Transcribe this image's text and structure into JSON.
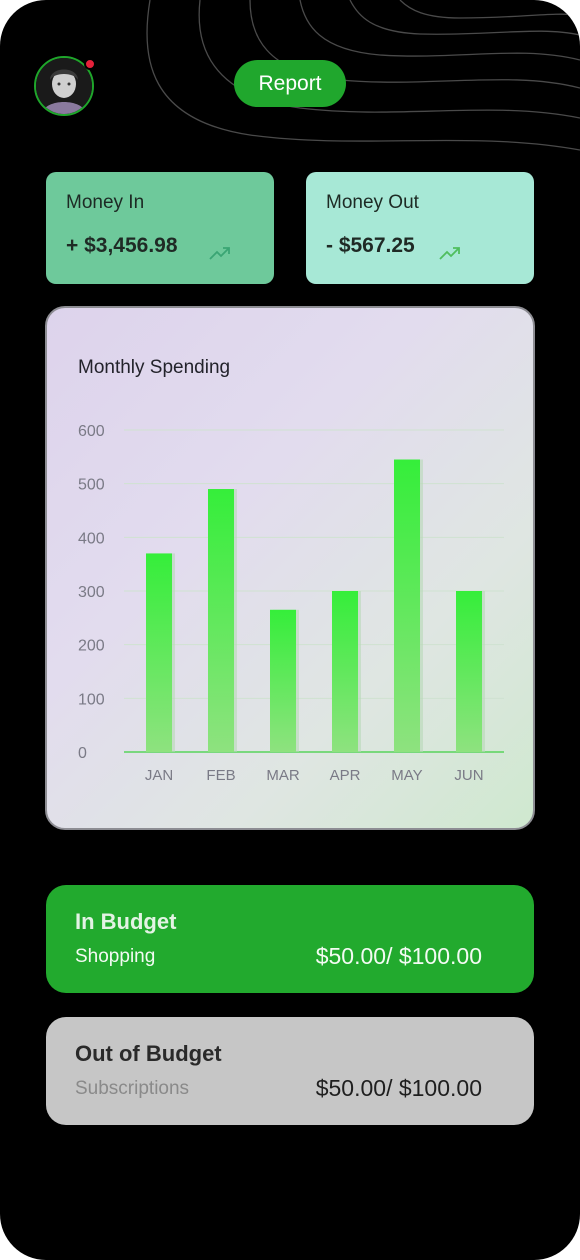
{
  "header": {
    "report_label": "Report",
    "has_notification": true
  },
  "summary": {
    "money_in": {
      "label": "Money In",
      "value": "+ $3,456.98",
      "trend_icon": "trending-up-icon"
    },
    "money_out": {
      "label": "Money Out",
      "value": "- $567.25",
      "trend_icon": "trending-up-icon"
    }
  },
  "chart_data": {
    "type": "bar",
    "title": "Monthly Spending",
    "xlabel": "",
    "ylabel": "",
    "categories": [
      "JAN",
      "FEB",
      "MAR",
      "APR",
      "MAY",
      "JUN"
    ],
    "values": [
      370,
      490,
      265,
      300,
      545,
      300
    ],
    "ylim": [
      0,
      600
    ],
    "yticks": [
      0,
      100,
      200,
      300,
      400,
      500,
      600
    ],
    "grid": true,
    "colors": {
      "bar_top": "#35ee3a",
      "bar_bottom": "#8ee27f",
      "axis": "#58d45c",
      "grid": "#cfe2d0",
      "tick_text": "#7a7a86"
    }
  },
  "budgets": [
    {
      "title": "In Budget",
      "category": "Shopping",
      "amount": "$50.00/ $100.00",
      "status": "in"
    },
    {
      "title": "Out of Budget",
      "category": "Subscriptions",
      "amount": "$50.00/ $100.00",
      "status": "out"
    }
  ],
  "colors": {
    "accent": "#20a72d",
    "money_in_card": "#6ec99b",
    "money_out_card": "#a7e8d6",
    "out_of_budget_card": "#c6c6c6",
    "notification": "#e5213a"
  }
}
